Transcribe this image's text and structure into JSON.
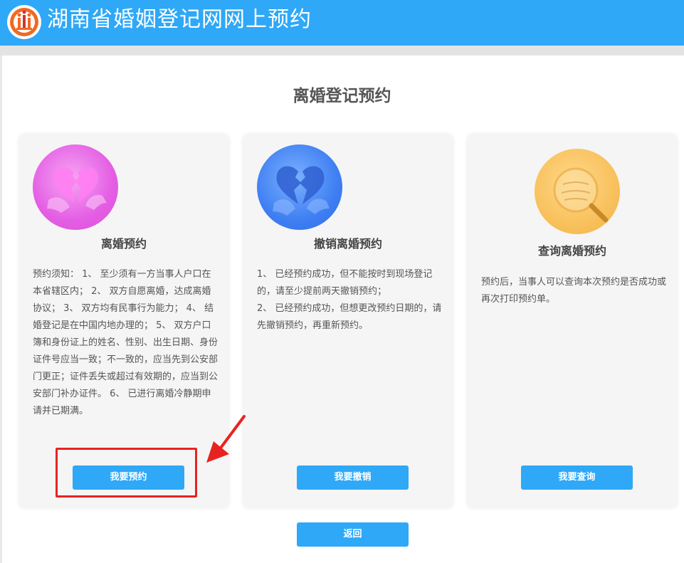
{
  "header": {
    "title": "湖南省婚姻登记网网上预约",
    "logo_icon": "marriage-registration-logo",
    "color": "#2ea8f7"
  },
  "page": {
    "title": "离婚登记预约"
  },
  "cards": [
    {
      "title": "离婚预约",
      "icon": "broken-heart-illustration",
      "icon_color": "#e45ee4",
      "description": "预约须知： 1、 至少须有一方当事人户口在本省辖区内； 2、 双方自愿离婚，达成离婚协议； 3、 双方均有民事行为能力； 4、 结婚登记是在中国内地办理的； 5、 双方户口簿和身份证上的姓名、性别、出生日期、身份证件号应当一致；不一致的，应当先到公安部门更正；证件丢失或超过有效期的，应当到公安部门补办证件。 6、 已进行离婚冷静期申请并已期满。",
      "button": "我要预约"
    },
    {
      "title": "撤销离婚预约",
      "icon": "mended-heart-illustration",
      "icon_color": "#3f7ff2",
      "description_lines": [
        "1、 已经预约成功，但不能按时到现场登记的，请至少提前两天撤销预约；",
        "2、 已经预约成功，但想更改预约日期的，请先撤销预约，再重新预约。"
      ],
      "button": "我要撤销"
    },
    {
      "title": "查询离婚预约",
      "icon": "magnifier-illustration",
      "icon_color": "#f8c15d",
      "description": "预约后，当事人可以查询本次预约是否成功或再次打印预约单。",
      "button": "我要查询"
    }
  ],
  "footer": {
    "back_button": "返回"
  },
  "annotation": {
    "highlight_color": "#e8231f"
  }
}
